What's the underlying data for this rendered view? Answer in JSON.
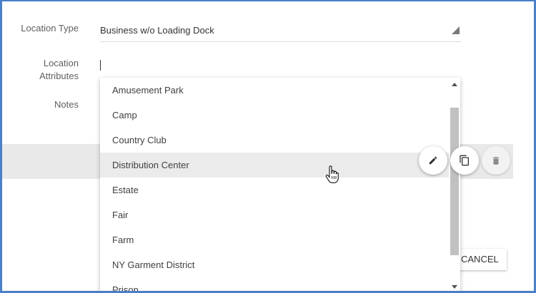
{
  "form": {
    "location_type": {
      "label": "Location Type",
      "value": "Business w/o Loading Dock"
    },
    "location_attributes": {
      "label_line1": "Location",
      "label_line2": "Attributes",
      "value": ""
    },
    "notes": {
      "label": "Notes"
    }
  },
  "dropdown": {
    "items": [
      {
        "label": "Amusement Park"
      },
      {
        "label": "Camp"
      },
      {
        "label": "Country Club"
      },
      {
        "label": "Distribution Center",
        "highlighted": true
      },
      {
        "label": "Estate"
      },
      {
        "label": "Fair"
      },
      {
        "label": "Farm"
      },
      {
        "label": "NY Garment District"
      },
      {
        "label": "Prison"
      }
    ]
  },
  "row_actions": {
    "edit_icon": "pencil-icon",
    "copy_icon": "copy-icon",
    "delete_icon": "trash-icon"
  },
  "footer": {
    "cancel_label": "CANCEL"
  },
  "colors": {
    "frame": "#4a7fc9",
    "highlight": "#ebebeb",
    "band": "#e9e9e9"
  }
}
